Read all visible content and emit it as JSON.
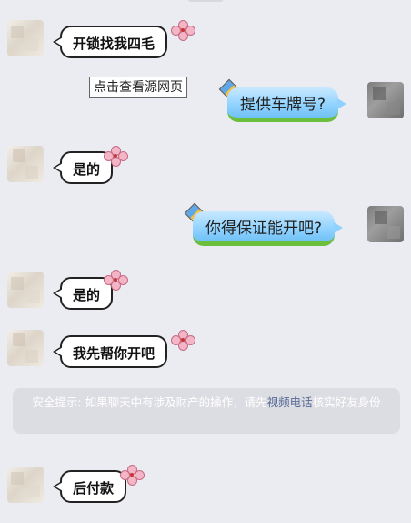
{
  "messages": [
    {
      "side": "left",
      "text": "开锁找我四毛"
    },
    {
      "side": "right",
      "text": "提供车牌号?"
    },
    {
      "side": "left",
      "text": "是的"
    },
    {
      "side": "right",
      "text": "你得保证能开吧?"
    },
    {
      "side": "left",
      "text": "是的"
    },
    {
      "side": "left",
      "text": "我先帮你开吧"
    },
    {
      "side": "left",
      "text": "后付款"
    }
  ],
  "tooltip": "点击查看源网页",
  "notice": {
    "prefix": "安全提示: 如果聊天中有涉及财产的操作，请先",
    "link": "视频电话",
    "suffix": "核实好友身份"
  },
  "colors": {
    "background": "#ebebf2",
    "right_bubble": "#8fd2ff",
    "link": "#576b95"
  }
}
